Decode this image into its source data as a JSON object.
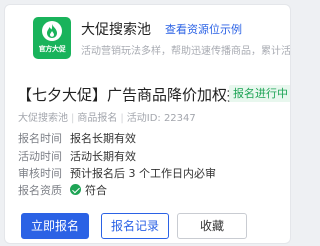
{
  "pool": {
    "logo_text": "官方大促",
    "title": "大促搜索池",
    "link": "查看资源位示例",
    "description": "活动营销玩法多样，帮助迅速传播商品，累计活跃"
  },
  "activity": {
    "title": "【七夕大促】广告商品降价加权报名",
    "status": "报名进行中",
    "meta": {
      "pool": "大促搜索池",
      "type": "商品报名",
      "id": "活动ID: 22347"
    }
  },
  "info_rows": [
    {
      "label": "报名时间",
      "value": "报名长期有效"
    },
    {
      "label": "活动时间",
      "value": "活动长期有效"
    },
    {
      "label": "审核时间",
      "value": "预计报名后 3 个工作日内必审"
    },
    {
      "label": "报名资质",
      "value": "符合"
    }
  ],
  "buttons": {
    "signup": "立即报名",
    "records": "报名记录",
    "favorite": "收藏"
  },
  "colors": {
    "brand_green": "#19b35b",
    "primary_blue": "#2b62e5",
    "status_green": "#1ea455"
  }
}
